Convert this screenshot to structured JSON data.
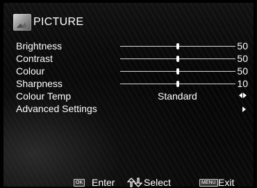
{
  "header": {
    "title": "PICTURE",
    "icon": "picture-icon"
  },
  "sliders": [
    {
      "label": "Brightness",
      "value": "50",
      "level": 50
    },
    {
      "label": "Contrast",
      "value": "50",
      "level": 50
    },
    {
      "label": "Colour",
      "value": "50",
      "level": 50
    },
    {
      "label": "Sharpness",
      "value": "10",
      "level": 50
    }
  ],
  "colour_temp": {
    "label": "Colour Temp",
    "value": "Standard"
  },
  "advanced": {
    "label": "Advanced Settings"
  },
  "footer": {
    "ok_key": "OK",
    "enter_label": "Enter",
    "select_label": "Select",
    "menu_key": "MENU",
    "exit_label": "Exit"
  }
}
